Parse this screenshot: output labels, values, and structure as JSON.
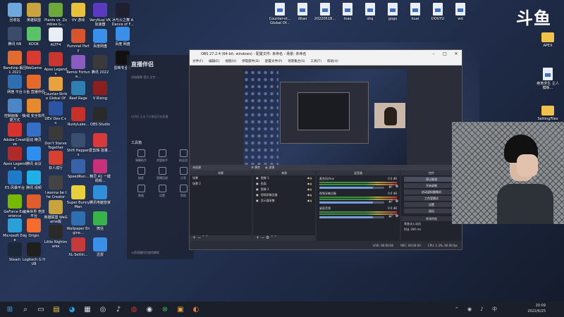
{
  "desktop": {
    "icons_col1": [
      {
        "label": "回收站",
        "icon": "recycle-bin-icon",
        "color": "#6fa8dc"
      },
      {
        "label": "腾讯 NN",
        "icon": "app-icon",
        "color": "#3b4c6b"
      },
      {
        "label": "Bandizip 解压 1 2021",
        "icon": "bandizip-icon",
        "color": "#e26b2f"
      },
      {
        "label": "网宿 平台",
        "icon": "app-icon",
        "color": "#2f6fb0"
      },
      {
        "label": "控制面板 - 快捷方式",
        "icon": "control-panel-icon",
        "color": "#4c86c6"
      },
      {
        "label": "Adobe Creative",
        "icon": "adobe-icon",
        "color": "#d8322f"
      },
      {
        "label": "Apex Legends",
        "icon": "apex-icon",
        "color": "#b02a2a"
      },
      {
        "label": "ES 风暴平台",
        "icon": "app-icon",
        "color": "#1f7ac9"
      },
      {
        "label": "GeForce Experience",
        "icon": "geforce-icon",
        "color": "#76b900"
      },
      {
        "label": "Microsoft Edge",
        "icon": "edge-icon",
        "color": "#2aa0d8"
      },
      {
        "label": "Steam",
        "icon": "steam-icon",
        "color": "#1b2838"
      }
    ],
    "icons_col2": [
      {
        "label": "英雄联盟",
        "icon": "lol-icon",
        "color": "#c9a33d"
      },
      {
        "label": "KOOK",
        "icon": "kook-icon",
        "color": "#5bc26a"
      },
      {
        "label": "WeGame",
        "icon": "wegame-icon",
        "color": "#d83a2f"
      },
      {
        "label": "斗鱼 直播伴侣",
        "icon": "app-icon",
        "color": "#e56a2a"
      },
      {
        "label": "火绒 安全软件",
        "icon": "huorong-icon",
        "color": "#e68a2e"
      },
      {
        "label": "驱动 精灵",
        "icon": "app-icon",
        "color": "#3670c4"
      },
      {
        "label": "腾讯 会议",
        "icon": "meeting-icon",
        "color": "#2f8ff0"
      },
      {
        "label": "腾讯 视频",
        "icon": "tencent-video-icon",
        "color": "#1fb0e8"
      },
      {
        "label": "完美世界 竞技平台",
        "icon": "app-icon",
        "color": "#e15d2e"
      },
      {
        "label": "Origin",
        "icon": "origin-icon",
        "color": "#f56c2d"
      },
      {
        "label": "Logitech G HUB",
        "icon": "logitech-icon",
        "color": "#1f1f1f"
      }
    ],
    "icons_col3": [
      {
        "label": "Plants vs. Zombies G...",
        "icon": "pvz-icon",
        "color": "#6ca83b"
      },
      {
        "label": "ALTF4",
        "icon": "file-icon",
        "color": "#e9edf5"
      },
      {
        "label": "Apex Legends",
        "icon": "apex-icon",
        "color": "#c9362f"
      },
      {
        "label": "Counter-Strike Global Off...",
        "icon": "csgo-icon",
        "color": "#e8a33c"
      },
      {
        "label": "DEV Dev-C++",
        "icon": "devcpp-icon",
        "color": "#2d54a3"
      },
      {
        "label": "Don't Starve Together",
        "icon": "dst-icon",
        "color": "#3a3a3a"
      },
      {
        "label": "双人成行",
        "icon": "app-icon",
        "color": "#d8402f"
      },
      {
        "label": "I wanna be the Creator",
        "icon": "app-icon",
        "color": "#444"
      },
      {
        "label": "英雄联盟 WeGame版",
        "icon": "lol-icon",
        "color": "#c9a33d"
      },
      {
        "label": "Little Nightmares",
        "icon": "app-icon",
        "color": "#2a2a2a"
      }
    ],
    "icons_col4": [
      {
        "label": "VV 游戏",
        "icon": "vv-icon",
        "color": "#e8c23a"
      },
      {
        "label": "Pummel Party",
        "icon": "app-icon",
        "color": "#d8542f"
      },
      {
        "label": "Remix Fortune...",
        "icon": "app-icon",
        "color": "#8a5cc0"
      },
      {
        "label": "Reef Rage",
        "icon": "app-icon",
        "color": "#2f7fb0"
      },
      {
        "label": "RustyLake...",
        "icon": "flash-icon",
        "color": "#c8302a"
      },
      {
        "label": "Shift Happens",
        "icon": "app-icon",
        "color": "#3a4f70"
      },
      {
        "label": "SpeedRun...",
        "icon": "app-icon",
        "color": "#3a62a8"
      },
      {
        "label": "Super Bunny Man",
        "icon": "app-icon",
        "color": "#e8d03a"
      },
      {
        "label": "Wallpaper Engine...",
        "icon": "app-icon",
        "color": "#2f6fb0"
      },
      {
        "label": "XL-Settin...",
        "icon": "app-icon",
        "color": "#c83a3a"
      }
    ],
    "icons_col5": [
      {
        "label": "VeryKuai VK 加速器",
        "icon": "app-icon",
        "color": "#5a3ac0"
      },
      {
        "label": "百度网盘",
        "icon": "app-icon",
        "color": "#3a8fe8"
      },
      {
        "label": "腾讯 2022",
        "icon": "app-icon",
        "color": "#3a3a3a"
      },
      {
        "label": "V Rising",
        "icon": "app-icon",
        "color": "#8a1f1f"
      },
      {
        "label": "OBS Studio",
        "icon": "obs-icon",
        "color": "#2a2a2a"
      },
      {
        "label": "爱剪辑 批量...",
        "icon": "app-icon",
        "color": "#d83a3a"
      },
      {
        "label": "精灵 A1 一键 视频...",
        "icon": "app-icon",
        "color": "#c8307a"
      },
      {
        "label": "腾讯电脑管家",
        "icon": "app-icon",
        "color": "#2f8fd8"
      },
      {
        "label": "微信",
        "icon": "wechat-icon",
        "color": "#38b34a"
      },
      {
        "label": "迅雷",
        "icon": "xunlei-icon",
        "color": "#3a8fe8"
      }
    ],
    "icons_col6": [
      {
        "label": "冰与火之舞 A Dance of F...",
        "icon": "app-icon",
        "color": "#1f1f2f"
      },
      {
        "label": "百度 网盘",
        "icon": "app-icon",
        "color": "#3a8fe8"
      },
      {
        "label": "剪映专业版",
        "icon": "capcut-icon",
        "color": "#111"
      }
    ],
    "top_files": [
      {
        "label": "Counter-st... Global Of...",
        "icon": "file-icon"
      },
      {
        "label": "ditao",
        "icon": "file-icon"
      },
      {
        "label": "2022051B...",
        "icon": "file-icon"
      },
      {
        "label": "mao",
        "icon": "file-icon"
      },
      {
        "label": "shq",
        "icon": "file-icon"
      },
      {
        "label": "gogo",
        "icon": "file-icon"
      },
      {
        "label": "kuai",
        "icon": "file-icon"
      },
      {
        "label": "DOUYU",
        "icon": "file-icon"
      },
      {
        "label": "wd",
        "icon": "file-icon"
      }
    ],
    "right_folders": [
      {
        "label": "APEX",
        "icon": "folder-icon"
      },
      {
        "label": "绝地求生 主人模板...",
        "icon": "file-icon"
      },
      {
        "label": "SettingFiles",
        "icon": "folder-icon"
      }
    ]
  },
  "logo": {
    "text": "斗鱼"
  },
  "companion": {
    "title": "直播伴侣",
    "tabs": "添加视频  音乐  文字  ...",
    "message": "(右侧) 点击下方按钮开始直播",
    "tools_header": "工具箱",
    "tools": [
      "弹幕助手",
      "房管助手",
      "粉丝团",
      "抽奖",
      "直播回放",
      "分享",
      "数据",
      "设置",
      "帮助"
    ],
    "bottom": "斗鱼直播伴侣使用教程"
  },
  "obs": {
    "title": "OBS 27.2.4 (64-bit, windows) - 配置文件: 未命名 - 场景: 未命名",
    "menu": [
      "文件(F)",
      "编辑(E)",
      "视图(V)",
      "停靠部件(D)",
      "配置文件(P)",
      "场景集合(S)",
      "工具(T)",
      "帮助(H)"
    ],
    "source_bar": "未选源",
    "props_label": "属性",
    "filters_label": "滤镜",
    "scenes_header": "场景",
    "scenes": [
      "场景",
      "场景 2"
    ],
    "sources_header": "来源",
    "sources": [
      "图像 3",
      "画面",
      "图像 2",
      "视频采集设备",
      "显示器采集"
    ],
    "mixer_header": "混音器",
    "mixer": [
      {
        "name": "麦克风/Aux",
        "db": "0.0 dB",
        "level": 0.82
      },
      {
        "name": "视频采集设备",
        "db": "0.0 dB",
        "level": 0.82
      },
      {
        "name": "桌面音频",
        "db": "0.0 dB",
        "level": 0.82
      }
    ],
    "transitions_header": "转场特效",
    "transition_type": "渐变淡入淡出",
    "duration_label": "时长",
    "duration_value": "300 ms",
    "controls_header": "控件",
    "controls": [
      "停止推流",
      "开始录制",
      "启动虚拟摄像机",
      "工作室模式",
      "设置",
      "退出"
    ],
    "status": [
      "LIVE: 00:00:00",
      "REC: 00:00:00",
      "CPU: 1.3%, 60.00 fps"
    ]
  },
  "taskbar": {
    "icons": [
      "windows-icon",
      "search-icon",
      "task-view-icon",
      "file-explorer-icon",
      "edge-icon",
      "store-icon",
      "steam-icon",
      "tiktok-icon",
      "netease-icon",
      "obs-icon",
      "xbox-icon",
      "app-icon",
      "douyu-icon"
    ],
    "time": "20:09",
    "date": "2022/6/25"
  }
}
